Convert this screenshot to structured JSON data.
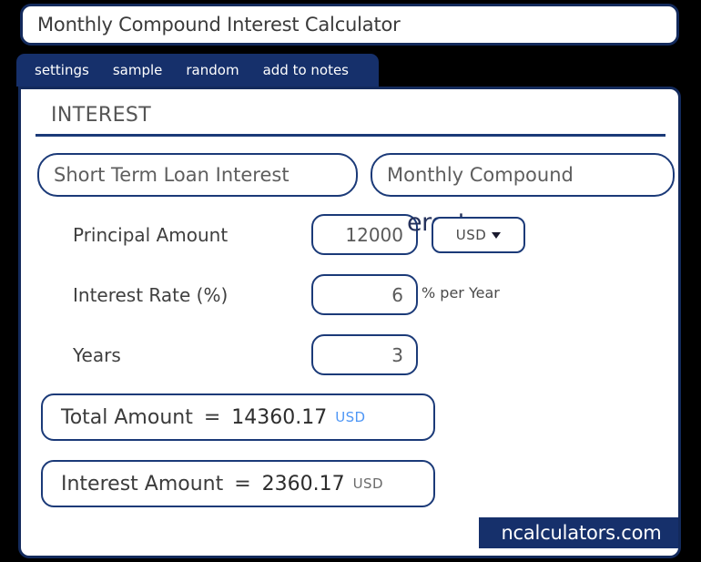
{
  "window": {
    "title": "Monthly Compound Interest Calculator"
  },
  "tabs": [
    {
      "label": "settings"
    },
    {
      "label": "sample"
    },
    {
      "label": "random"
    },
    {
      "label": "add to notes"
    }
  ],
  "section": {
    "heading": "INTEREST"
  },
  "selectors": {
    "calculation_type": "Short Term Loan Interest",
    "compound_frequency": "Monthly Compound"
  },
  "artifact": {
    "clipped_text": "erest"
  },
  "fields": [
    {
      "label": "Principal Amount",
      "value": "12000",
      "currency": "USD",
      "suffix": ""
    },
    {
      "label": "Interest Rate (%)",
      "value": "6",
      "currency": "",
      "suffix": "% per Year"
    },
    {
      "label": "Years",
      "value": "3",
      "currency": "",
      "suffix": ""
    }
  ],
  "results": [
    {
      "label": "Total Amount",
      "equals": "=",
      "value": "14360.17",
      "currency": "USD"
    },
    {
      "label": "Interest Amount",
      "equals": "=",
      "value": "2360.17",
      "currency": "USD"
    }
  ],
  "footer": {
    "watermark": "ncalculators.com"
  },
  "colors": {
    "page_background": "#000000",
    "border_navy": "#132a5c",
    "tab_bar": "#16306b",
    "accent_blue": "#4e96f5",
    "card_background": "#ffffff"
  }
}
